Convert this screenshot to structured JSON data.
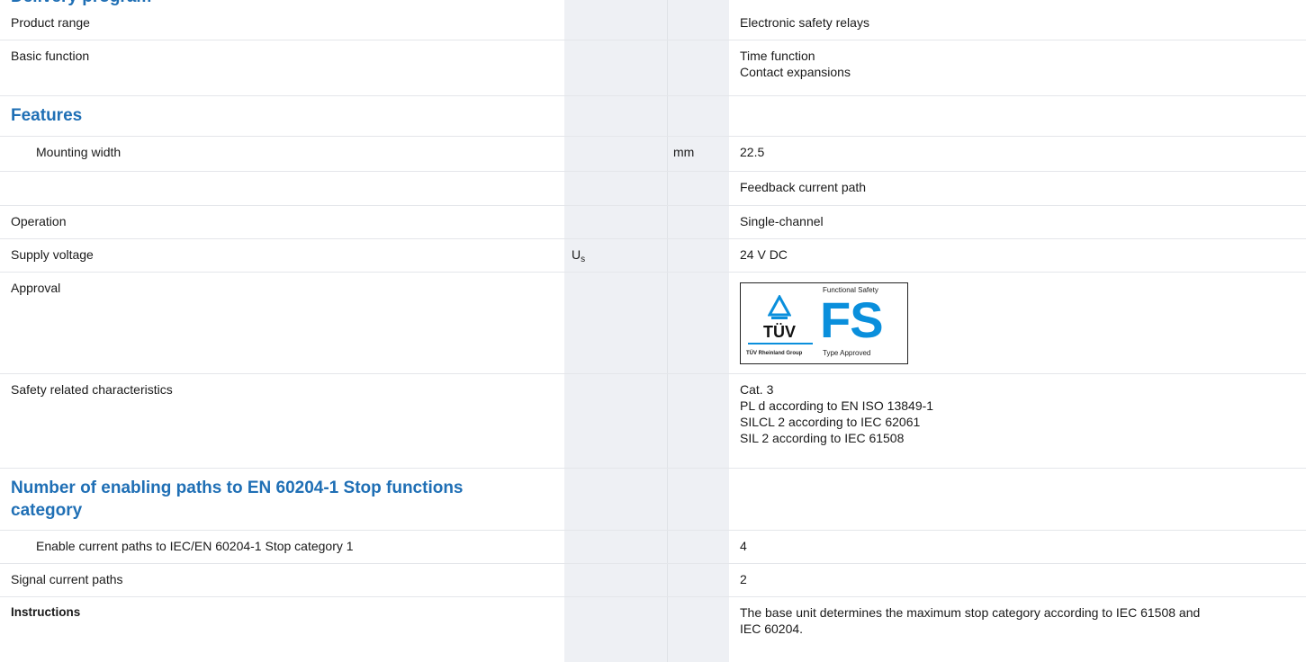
{
  "cut_heading": "Delivery program",
  "rows": {
    "product_range": {
      "label": "Product range",
      "value": "Electronic safety relays"
    },
    "basic_function": {
      "label": "Basic function",
      "value": "Time function\nContact expansions"
    },
    "features_heading": "Features",
    "mounting_width": {
      "label": "Mounting width",
      "unit": "mm",
      "value": "22.5"
    },
    "feedback": {
      "value": "Feedback current path"
    },
    "operation": {
      "label": "Operation",
      "value": "Single-channel"
    },
    "supply_voltage": {
      "label": "Supply voltage",
      "symbol": "U",
      "symbol_sub": "s",
      "value": "24 V DC"
    },
    "approval": {
      "label": "Approval",
      "badge": {
        "top_text": "Functional Safety",
        "letters": "FS",
        "bottom_text": "Type Approved",
        "tuv_text": "TÜV",
        "tuv_group": "TÜV Rheinland Group"
      }
    },
    "safety": {
      "label": "Safety related characteristics",
      "value": "Cat. 3\nPL d according to EN ISO 13849-1\nSILCL 2 according to IEC 62061\nSIL 2 according to IEC 61508"
    },
    "enabling_heading": "Number of enabling paths to EN 60204-1 Stop functions category",
    "enable_paths": {
      "label": "Enable current paths to IEC/EN 60204-1 Stop category 1",
      "value": "4"
    },
    "signal_paths": {
      "label": "Signal current paths",
      "value": "2"
    },
    "instructions": {
      "label": "Instructions",
      "value": "The base unit determines the maximum stop category according to IEC 61508 and\nIEC 60204."
    }
  },
  "colors": {
    "heading": "#1f6fb5",
    "shade": "#eef0f4",
    "fs_blue": "#0a8fdc"
  }
}
